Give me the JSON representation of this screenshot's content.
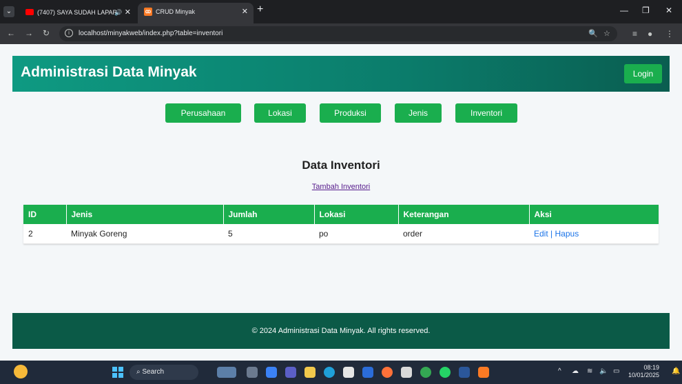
{
  "browser": {
    "tabs": [
      {
        "title": "(7407) SAYA SUDAH LAPAR",
        "icon": "youtube-icon",
        "active": false
      },
      {
        "title": "CRUD Minyak",
        "icon": "xampp-icon",
        "active": true
      }
    ],
    "url": "localhost/minyakweb/index.php?table=inventori"
  },
  "header": {
    "title": "Administrasi Data Minyak",
    "login_label": "Login"
  },
  "nav": [
    {
      "label": "Perusahaan"
    },
    {
      "label": "Lokasi"
    },
    {
      "label": "Produksi"
    },
    {
      "label": "Jenis"
    },
    {
      "label": "Inventori"
    }
  ],
  "section": {
    "title": "Data Inventori",
    "add_label": "Tambah Inventori"
  },
  "table": {
    "columns": [
      "ID",
      "Jenis",
      "Jumlah",
      "Lokasi",
      "Keterangan",
      "Aksi"
    ],
    "rows": [
      {
        "id": "2",
        "jenis": "Minyak Goreng",
        "jumlah": "5",
        "lokasi": "po",
        "keterangan": "order",
        "edit": "Edit",
        "sep": "|",
        "hapus": "Hapus"
      }
    ]
  },
  "footer": {
    "text": "© 2024 Administrasi Data Minyak. All rights reserved."
  },
  "taskbar": {
    "search_label": "Search",
    "time": "08:19",
    "date": "10/01/2025"
  },
  "colors": {
    "header_gradient_start": "#0e9a82",
    "header_gradient_end": "#0a5d50",
    "button_green": "#1aae4e",
    "footer": "#0b5a47",
    "link_blue": "#1a73e8"
  }
}
